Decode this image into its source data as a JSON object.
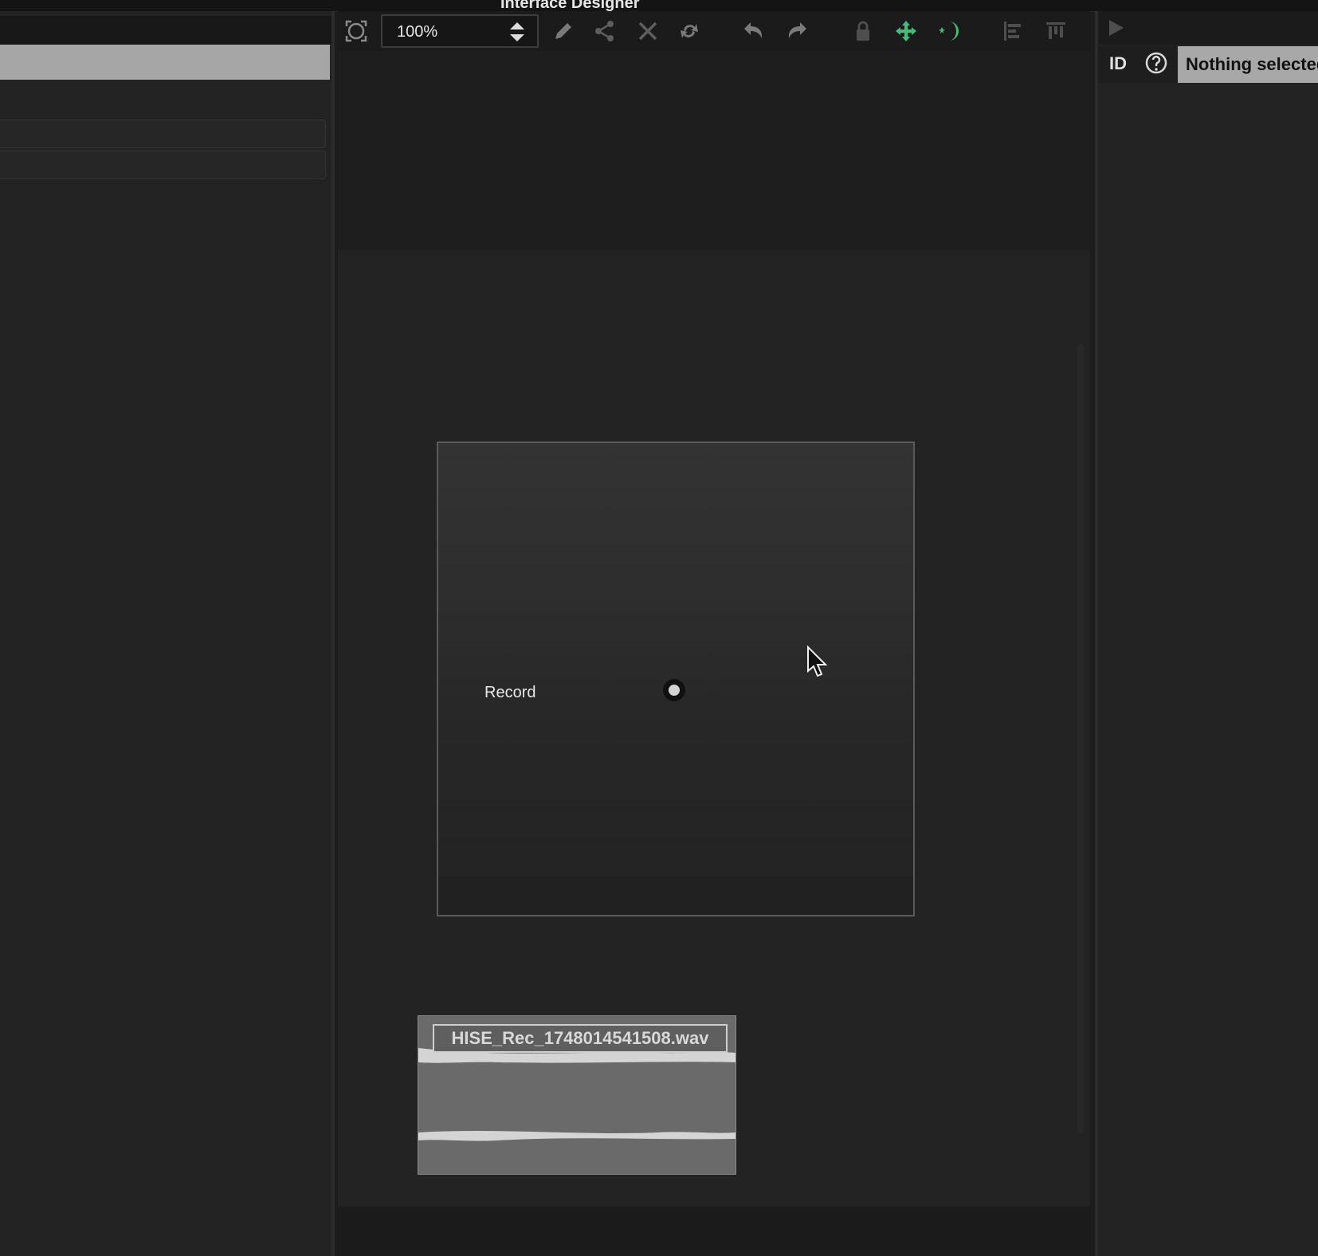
{
  "window": {
    "title": "Interface Designer"
  },
  "toolbar": {
    "zoom_value": "100%",
    "icons": {
      "zoom_fit": "zoom-fit-icon",
      "edit": "pencil-icon",
      "share": "share-icon",
      "delete": "close-icon",
      "rebuild": "refresh-icon",
      "undo": "undo-icon",
      "redo": "redo-icon",
      "lock": "lock-icon",
      "move": "move-icon",
      "presentation": "moon-icon",
      "align_left": "align-left-icon",
      "align_top": "align-top-icon"
    },
    "accent_color": "#3fbf7a"
  },
  "interface": {
    "record_label": "Record"
  },
  "audio_file": {
    "name": "HISE_Rec_1748014541508.wav"
  },
  "properties": {
    "id_label": "ID",
    "selection_status": "Nothing selected"
  }
}
